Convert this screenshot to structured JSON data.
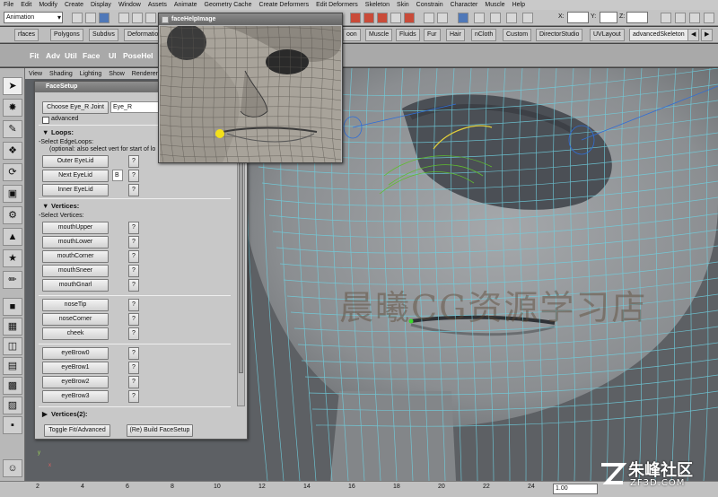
{
  "menubar": {
    "items": [
      "File",
      "Edit",
      "Modify",
      "Create",
      "Display",
      "Window",
      "Assets",
      "Animate",
      "Geometry Cache",
      "Create Deformers",
      "Edit Deformers",
      "Skeleton",
      "Skin",
      "Constrain",
      "Character",
      "Muscle",
      "Help"
    ]
  },
  "status": {
    "mode": "Animation",
    "x_label": "X:",
    "y_label": "Y:",
    "z_label": "Z:"
  },
  "shelf_tabs": [
    "rfaces",
    "Polygons",
    "Subdivs",
    "Deformatio",
    "oon",
    "Muscle",
    "Fluids",
    "Fur",
    "Hair",
    "nCloth",
    "Custom",
    "DirectorStudio",
    "UVLayout",
    "advancedSkeleton"
  ],
  "shelf_tools": [
    "Fit",
    "Adv",
    "Util",
    "Face",
    "UI",
    "PoseHel"
  ],
  "viewport": {
    "menu": [
      "View",
      "Shading",
      "Lighting",
      "Show",
      "Renderer"
    ],
    "watermark": "晨曦CG资源学习店",
    "axis_x": "x",
    "axis_y": "y"
  },
  "facesetup": {
    "title": "FaceSetup",
    "choose_eye_button": "Choose Eye_R Joint",
    "eye_joint_value": "Eye_R",
    "advanced_label": "advanced",
    "loops_header": "Loops:",
    "select_edgeloops": "-Select EdgeLoops:",
    "edgeloops_hint": "(optional: also select vert for start of lo",
    "loop_buttons": [
      "Outer EyeLid",
      "Next EyeLid",
      "Inner EyeLid"
    ],
    "next_eyelid_value": "B",
    "vertices_header": "Vertices:",
    "select_vertices": "-Select Vertices:",
    "vertex_buttons": [
      "mouthUpper",
      "mouthLower",
      "mouthCorner",
      "mouthSneer",
      "mouthGnarl"
    ],
    "nose_buttons": [
      "noseTip",
      "noseCorner",
      "cheek"
    ],
    "eyebrow_buttons": [
      "eyeBrow0",
      "eyeBrow1",
      "eyeBrow2",
      "eyeBrow3"
    ],
    "help_label": "?",
    "next_section": "Vertices(2):",
    "toggle_button": "Toggle Fit/Advanced",
    "build_button": "(Re) Build FaceSetup"
  },
  "helpwin": {
    "title": "faceHelpImage"
  },
  "timeslider": {
    "ticks": [
      "2",
      "4",
      "6",
      "8",
      "10",
      "12",
      "14",
      "16",
      "18",
      "20",
      "22",
      "24"
    ],
    "current_time": "1.00"
  },
  "site_logo": {
    "name": "朱峰社区",
    "url": "ZF3D.COM"
  },
  "colors": {
    "wire": "#6fd0e0",
    "mesh": "#8c8f92",
    "dialog": "#c8c8c8",
    "highlight": "#f3e01a"
  }
}
